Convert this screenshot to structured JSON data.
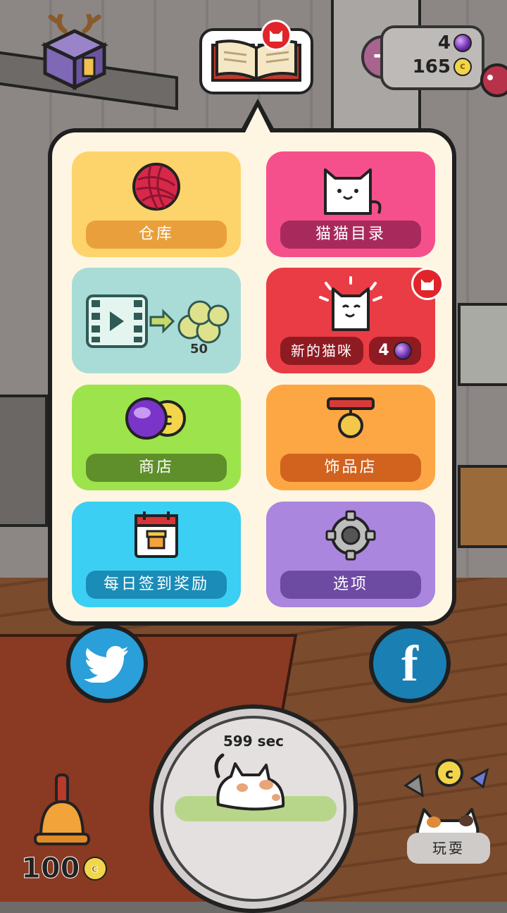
{
  "hud": {
    "gems": "4",
    "coins": "165",
    "coin_symbol": "c"
  },
  "menu": {
    "storage_label": "仓库",
    "catalog_label": "猫猫目录",
    "video_reward": "50",
    "newcat_label": "新的猫咪",
    "newcat_cost": "4",
    "shop_label": "商店",
    "accessory_label": "饰品店",
    "daily_label": "每日签到奖励",
    "options_label": "选项"
  },
  "social": {
    "facebook_glyph": "f"
  },
  "bottom": {
    "timer": "599 sec",
    "bell_count": "100",
    "play_label": "玩耍"
  },
  "colors": {
    "storage": "#fdd36b",
    "catalog": "#f6508c",
    "video": "#a9dcd6",
    "newcat": "#ea3c44",
    "shop": "#9de34c",
    "accessory": "#fda644",
    "daily": "#3ccff4",
    "options": "#aa86de"
  },
  "icons": [
    "house-icon",
    "book-icon",
    "gem-icon",
    "coin-icon",
    "yarn-icon",
    "cat-icon",
    "video-icon",
    "gear-icon",
    "calendar-icon",
    "collar-icon",
    "bell-icon",
    "twitter-icon",
    "facebook-icon"
  ]
}
